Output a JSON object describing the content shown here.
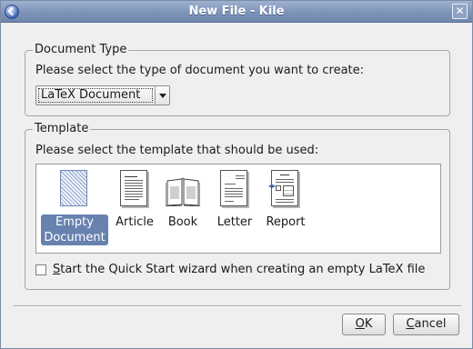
{
  "window": {
    "title": "New File - Kile"
  },
  "document_type": {
    "group_title": "Document Type",
    "prompt": "Please select the type of document you want to create:",
    "selected": "LaTeX Document"
  },
  "template": {
    "group_title": "Template",
    "prompt": "Please select the template that should be used:",
    "items": [
      {
        "label_line1": "Empty",
        "label_line2": "Document",
        "icon": "empty-document-icon",
        "selected": true
      },
      {
        "label_line1": "Article",
        "label_line2": "",
        "icon": "article-icon",
        "selected": false
      },
      {
        "label_line1": "Book",
        "label_line2": "",
        "icon": "book-icon",
        "selected": false
      },
      {
        "label_line1": "Letter",
        "label_line2": "",
        "icon": "letter-icon",
        "selected": false
      },
      {
        "label_line1": "Report",
        "label_line2": "",
        "icon": "report-icon",
        "selected": false
      }
    ]
  },
  "quick_start": {
    "label_first": "S",
    "label_rest": "tart the Quick Start wizard when creating an empty LaTeX file",
    "checked": false
  },
  "buttons": {
    "ok_first": "O",
    "ok_rest": "K",
    "cancel_first": "C",
    "cancel_rest": "ancel"
  },
  "colors": {
    "titlebar": "#7d93b8",
    "selection": "#6882af"
  }
}
